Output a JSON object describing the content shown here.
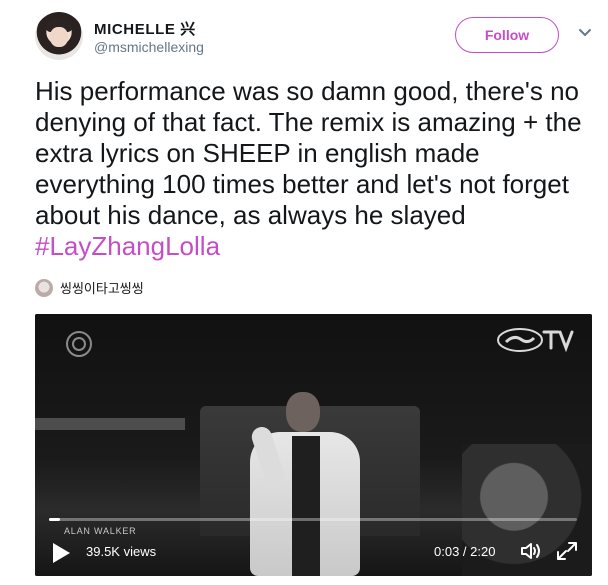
{
  "user": {
    "display_name": "MICHELLE 兴",
    "handle": "@msmichellexing",
    "avatar_icon": "profile-photo"
  },
  "follow_button": {
    "label": "Follow",
    "color": "#c44ec6"
  },
  "menu": {
    "caret_icon": "chevron-down-icon"
  },
  "tweet": {
    "text": "His performance was so damn good, there's no denying of that fact. The remix is amazing + the extra lyrics on SHEEP in english made everything 100 times better and let's not forget about his dance, as always he slayed ",
    "hashtag": "#LayZhangLolla",
    "hashtag_color": "#c44ec6"
  },
  "mention": {
    "name": "씽씽이타고씽씽"
  },
  "video": {
    "watermark": "ALAN WALKER",
    "views": "39.5K views",
    "time": "0:03 / 2:20",
    "progress": 0.02
  }
}
